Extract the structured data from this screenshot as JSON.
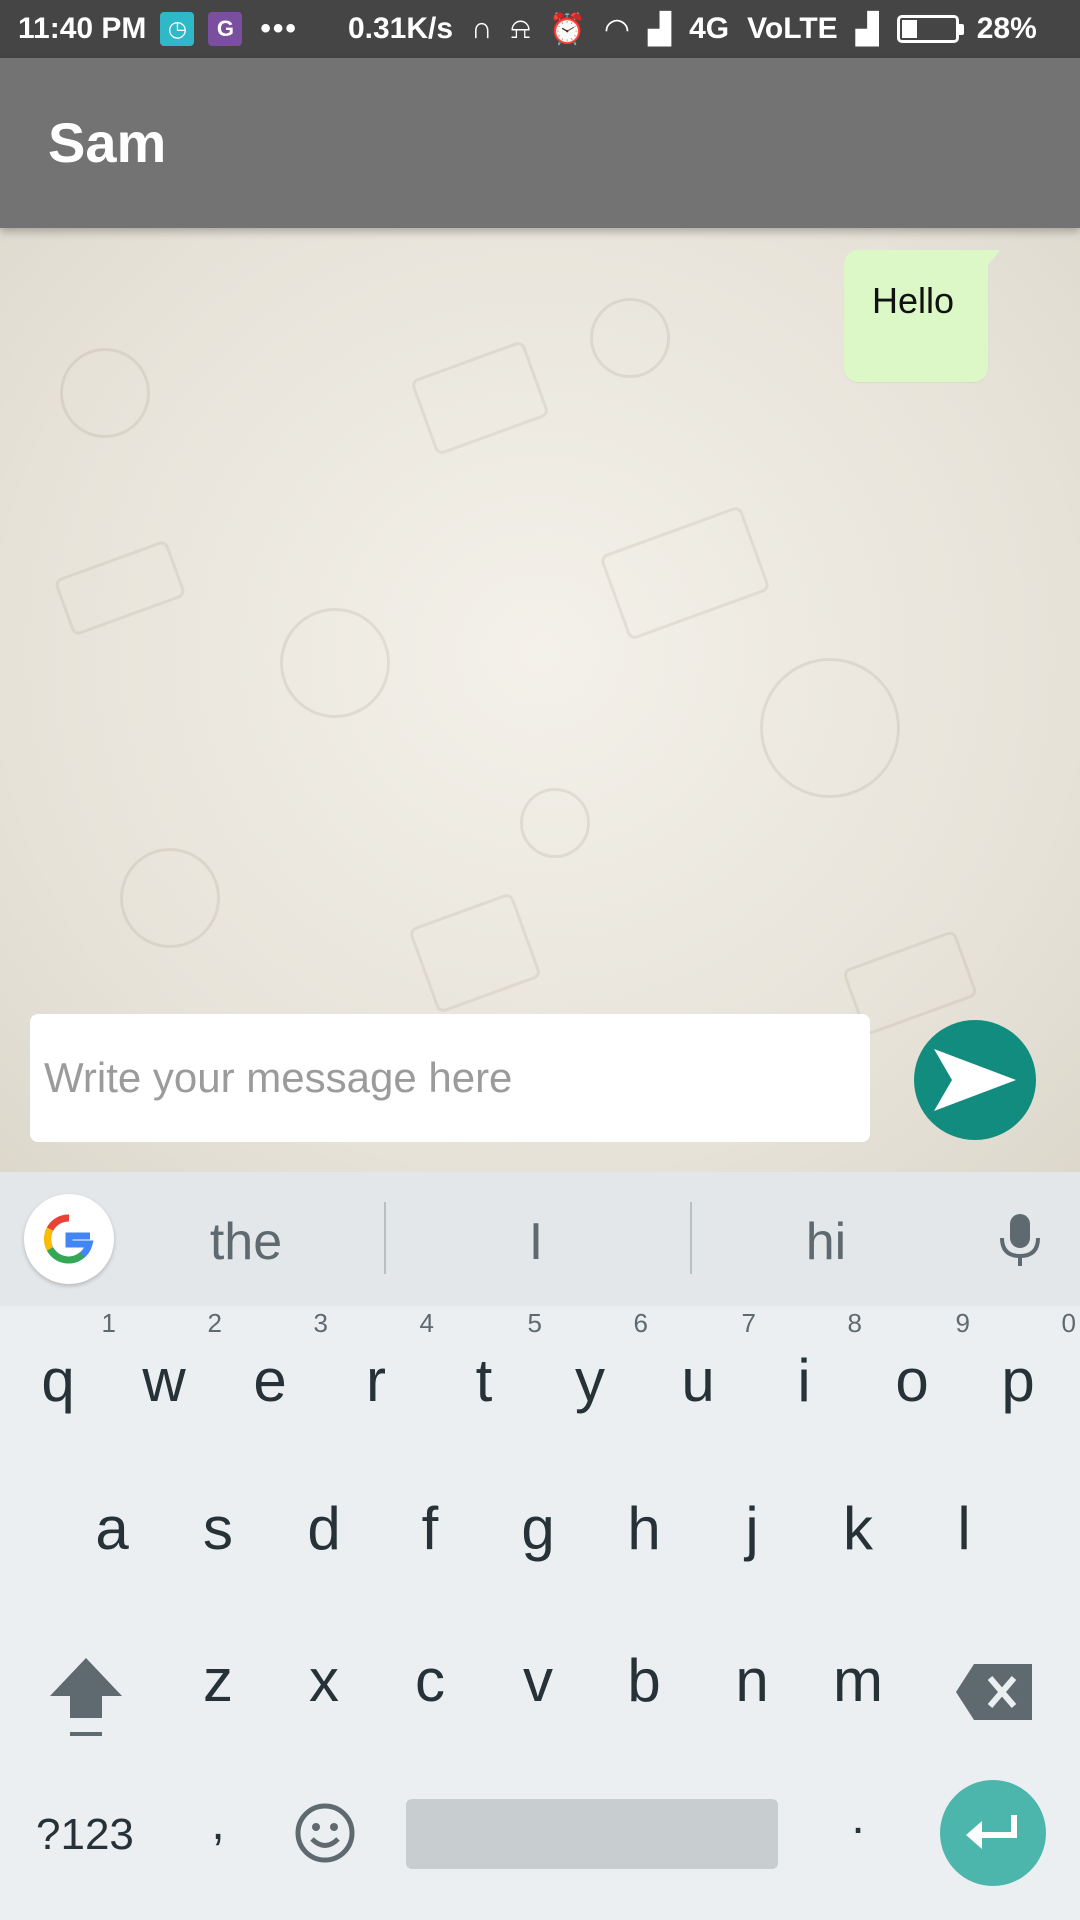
{
  "status_bar": {
    "time": "11:40 PM",
    "g_letter": "G",
    "dots": "•••",
    "speed": "0.31K/s",
    "network": "4G",
    "volte": "VoLTE",
    "battery": "28%",
    "battery_level": 0.28
  },
  "app_bar": {
    "title": "Sam"
  },
  "messages": [
    {
      "text": "Hello",
      "direction": "outgoing"
    }
  ],
  "composer": {
    "placeholder": "Write your message here",
    "value": ""
  },
  "keyboard": {
    "suggestions": [
      "the",
      "I",
      "hi"
    ],
    "row1": [
      "q",
      "w",
      "e",
      "r",
      "t",
      "y",
      "u",
      "i",
      "o",
      "p"
    ],
    "row1_hints": [
      "1",
      "2",
      "3",
      "4",
      "5",
      "6",
      "7",
      "8",
      "9",
      "0"
    ],
    "row2": [
      "a",
      "s",
      "d",
      "f",
      "g",
      "h",
      "j",
      "k",
      "l"
    ],
    "row3": [
      "z",
      "x",
      "c",
      "v",
      "b",
      "n",
      "m"
    ],
    "symbols_label": "?123",
    "comma": ",",
    "period": "."
  },
  "colors": {
    "app_bar": "#737373",
    "bubble": "#dcf8c6",
    "send": "#128c7e",
    "enter": "#4db6ac"
  }
}
